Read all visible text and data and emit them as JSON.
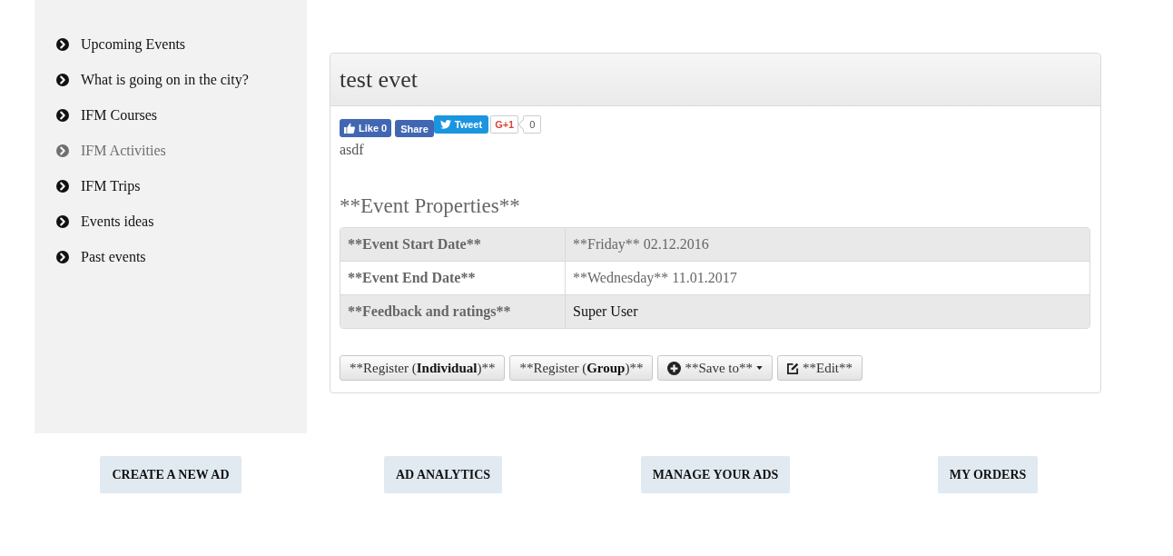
{
  "sidebar": {
    "items": [
      {
        "label": "Upcoming Events",
        "selected": false
      },
      {
        "label": "What is going on in the city?",
        "selected": false
      },
      {
        "label": "IFM Courses",
        "selected": false
      },
      {
        "label": "IFM Activities",
        "selected": true
      },
      {
        "label": "IFM Trips",
        "selected": false
      },
      {
        "label": "Events ideas",
        "selected": false
      },
      {
        "label": "Past events",
        "selected": false
      }
    ]
  },
  "event": {
    "title": "test evet",
    "social": [
      {
        "kind": "like",
        "label": "Like 0"
      },
      {
        "kind": "share",
        "label": "Share"
      },
      {
        "kind": "tweet",
        "label": "Tweet"
      },
      {
        "kind": "plusone",
        "label": "G+1"
      },
      {
        "kind": "count",
        "label": "0"
      }
    ],
    "description": "asdf",
    "properties_heading": "**Event Properties**",
    "properties": [
      {
        "name": "**Event Start Date**",
        "value": "**Friday** 02.12.2016",
        "kind": "date"
      },
      {
        "name": "**Event End Date**",
        "value": "**Wednesday** 11.01.2017",
        "kind": "date"
      },
      {
        "name": "**Feedback and ratings**",
        "value": "Super User",
        "kind": "user"
      }
    ],
    "actions": [
      {
        "kind": "plain",
        "parts": [
          {
            "text": "**Register (",
            "bold": false
          },
          {
            "text": "Individual",
            "bold": true
          },
          {
            "text": ")**",
            "bold": false
          }
        ]
      },
      {
        "kind": "plain",
        "parts": [
          {
            "text": "**Register (",
            "bold": false
          },
          {
            "text": "Group",
            "bold": true
          },
          {
            "text": ")**",
            "bold": false
          }
        ]
      },
      {
        "kind": "dropdown",
        "parts": [
          {
            "text": "**Save to**",
            "bold": false
          }
        ]
      },
      {
        "kind": "edit",
        "parts": [
          {
            "text": "**Edit**",
            "bold": false
          }
        ]
      }
    ]
  },
  "footer_buttons": [
    "CREATE A NEW AD",
    "AD ANALYTICS",
    "MANAGE YOUR ADS",
    "MY ORDERS"
  ]
}
